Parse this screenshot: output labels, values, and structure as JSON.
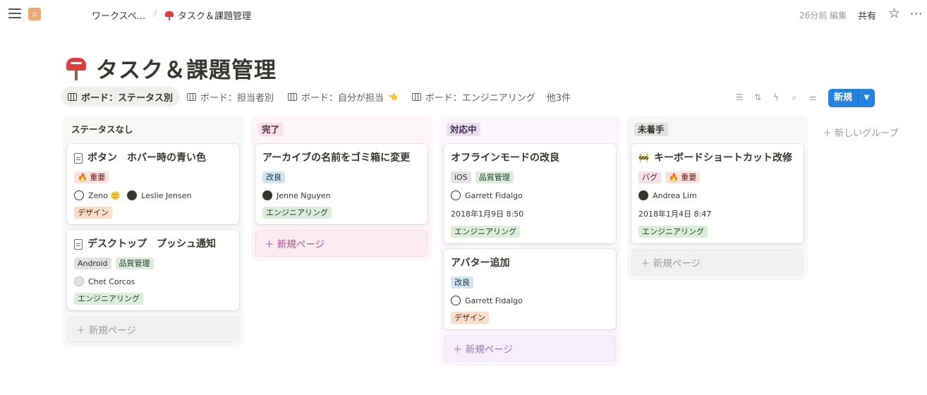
{
  "breadcrumb": {
    "workspace": "ワークスペ...",
    "separator": "/",
    "page": "タスク＆課題管理"
  },
  "topbar": {
    "edited": "26分前 編集",
    "share": "共有",
    "star_icon": "star-icon",
    "more": "···"
  },
  "page": {
    "title": "タスク＆課題管理"
  },
  "views": [
    {
      "label": "ボード：ステータス別",
      "active": true
    },
    {
      "label": "ボード：担当者別",
      "active": false
    },
    {
      "label": "ボード：自分が担当",
      "active": false
    },
    {
      "label": "ボード：エンジニアリング",
      "active": false
    }
  ],
  "more_views": "他3件",
  "new_button": {
    "label": "新規"
  },
  "columns": [
    {
      "label": "ステータスなし",
      "cards": [
        {
          "title": "ボタン　ホバー時の青い色",
          "tags": [
            "🔥 重要"
          ],
          "people": [
            "Zeno 🙂",
            "Leslie Jensen"
          ],
          "category": "デザイン"
        },
        {
          "title": "デスクトップ　プッシュ通知",
          "tags": [
            "Android",
            "品質管理"
          ],
          "people": [
            "Chet Corcos"
          ],
          "category": "エンジニアリング"
        }
      ],
      "new_page": "＋ 新規ページ"
    },
    {
      "label": "完了",
      "cards": [
        {
          "title": "アーカイブの名前をゴミ箱に変更",
          "tags": [
            "改良"
          ],
          "people": [
            "Jenne Nguyen"
          ],
          "category": "エンジニアリング"
        }
      ],
      "new_page": "＋ 新規ページ"
    },
    {
      "label": "対応中",
      "cards": [
        {
          "title": "オフラインモードの改良",
          "tags": [
            "iOS",
            "品質管理"
          ],
          "people": [
            "Garrett Fidalgo"
          ],
          "date": "2018年1月9日 8:50",
          "category": "エンジニアリング"
        },
        {
          "title": "アバター追加",
          "tags": [
            "改良"
          ],
          "people": [
            "Garrett Fidalgo"
          ],
          "category": "デザイン"
        }
      ],
      "new_page": "＋ 新規ページ"
    },
    {
      "label": "未着手",
      "cards": [
        {
          "title": "キーボードショートカット改修",
          "tags": [
            "バグ",
            "🔥 重要"
          ],
          "people": [
            "Andrea Lim"
          ],
          "date": "2018年1月4日 8:47",
          "category": "エンジニアリング"
        }
      ],
      "new_page": "＋ 新規ページ"
    }
  ],
  "add_group": "＋ 新しいグループ",
  "colors": {
    "accent": "#2383e2",
    "tag_red": "#ffe2dd",
    "tag_blue": "#d3e5ef",
    "tag_gray": "#e3e2e0",
    "tag_green": "#dbeddb",
    "tag_orange": "#fadec9",
    "tag_pink": "#f5e0e9",
    "tag_purple": "#e8deee"
  }
}
